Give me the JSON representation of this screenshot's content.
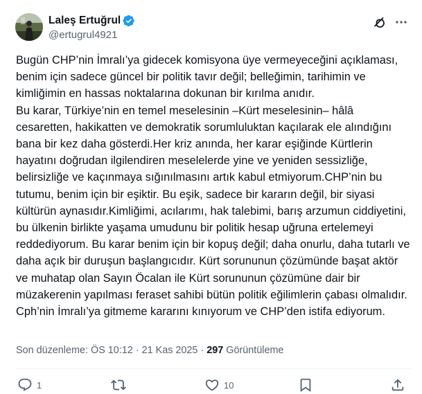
{
  "author": {
    "display_name": "Laleş Ertuğrul",
    "handle": "@ertugrul4921",
    "verified": true
  },
  "tweet": {
    "text": "Bugün CHP’nin İmralı’ya gidecek komisyona üye vermeyeceğini açıklaması, benim için sadece güncel bir politik tavır değil; belleğimin, tarihimin ve kimliğimin en hassas noktalarına dokunan bir kırılma anıdır.\nBu karar, Türkiye’nin en temel meselesinin –Kürt meselesinin– hâlâ cesaretten, hakikatten ve demokratik sorumluluktan kaçılarak ele alındığını bana bir kez daha gösterdi.Her kriz anında, her karar eşiğinde Kürtlerin hayatını doğrudan ilgilendiren meselelerde yine ve yeniden sessizliğe, belirsizliğe ve kaçınmaya sığınılmasını artık kabul etmiyorum.CHP’nin bu tutumu, benim için bir eşiktir. Bu eşik, sadece bir kararın değil, bir siyasi kültürün aynasıdır.Kimliğimi, acılarımı, hak talebimi, barış arzumun ciddiyetini, bu ülkenin birlikte yaşama umudunu bir politik hesap uğruna ertelemeyi reddediyorum. Bu karar benim için bir kopuş değil; daha onurlu, daha tutarlı ve daha açık bir duruşun başlangıcıdır. Kürt sorununun çözümünde başat aktör ve muhatap olan Sayın Öcalan ile Kürt sorununun çözümüne dair bir müzakerenin yapılması feraset sahibi bütün politik eğilimlerin çabası olmalıdır. Cph’nin İmralı’ya gitmeme kararını kınıyorum ve CHP’den istifa ediyorum.",
    "edited_label": "Son düzenleme: ÖS 10:12",
    "separator": "·",
    "date": "21 Kas 2025",
    "views_count": "297",
    "views_label": "Görüntüleme"
  },
  "actions": {
    "reply_count": "1",
    "repost_count": "",
    "like_count": "10"
  },
  "icons": {
    "verified": "verified-badge-icon",
    "grok": "grok-icon",
    "more": "more-icon",
    "reply": "reply-icon",
    "repost": "repost-icon",
    "like": "like-icon",
    "bookmark": "bookmark-icon",
    "share": "share-icon"
  },
  "colors": {
    "text": "#0f1419",
    "secondary": "#536471",
    "verified": "#1d9bf0"
  }
}
